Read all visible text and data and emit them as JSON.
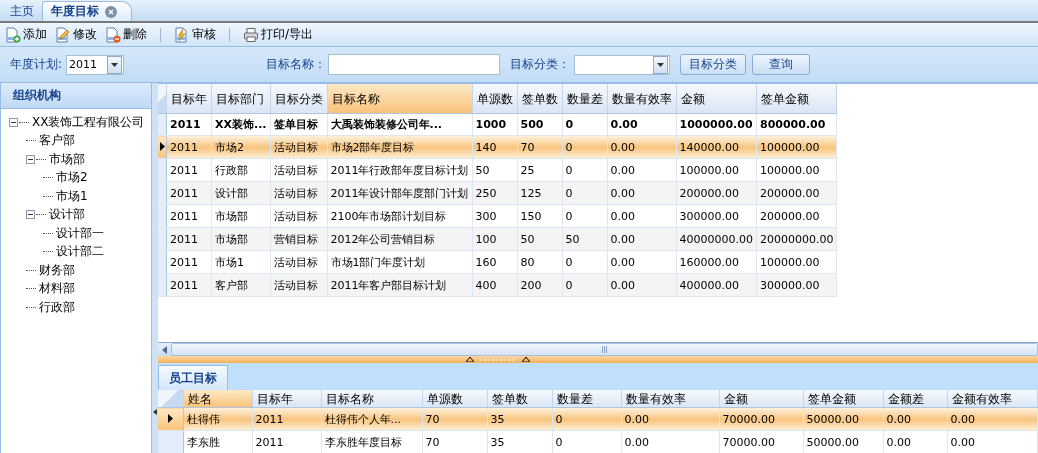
{
  "tabs": [
    {
      "label": "主页",
      "selected": false,
      "closable": false
    },
    {
      "label": "年度目标",
      "selected": true,
      "closable": true
    }
  ],
  "toolbar": [
    {
      "kind": "button",
      "label": "添加"
    },
    {
      "kind": "button",
      "label": "修改"
    },
    {
      "kind": "button",
      "label": "删除"
    },
    {
      "kind": "separator"
    },
    {
      "kind": "button",
      "label": "审核"
    },
    {
      "kind": "separator"
    },
    {
      "kind": "button",
      "label": "打印/导出"
    }
  ],
  "filters": {
    "year_plan": {
      "label": "年度计划:",
      "value": "2011"
    },
    "target_name": {
      "label": "目标名称："
    },
    "target_category": {
      "label": "目标分类："
    },
    "buttons": [
      "目标分类",
      "查询"
    ]
  },
  "sidebar": {
    "title": "组织机构",
    "tree": [
      {
        "label": "XX装饰工程有限公司",
        "expanded": true,
        "children": [
          {
            "label": "客户部"
          },
          {
            "label": "市场部",
            "expanded": true,
            "children": [
              {
                "label": "市场2"
              },
              {
                "label": "市场1"
              }
            ]
          },
          {
            "label": "设计部",
            "expanded": true,
            "children": [
              {
                "label": "设计部一"
              },
              {
                "label": "设计部二"
              }
            ]
          },
          {
            "label": "财务部"
          },
          {
            "label": "材料部"
          },
          {
            "label": "行政部"
          }
        ]
      }
    ]
  },
  "main_table": {
    "columns": [
      {
        "label": "目标年",
        "selected": false
      },
      {
        "label": "目标部门",
        "selected": false
      },
      {
        "label": "目标分类",
        "selected": false
      },
      {
        "label": "目标名称",
        "selected": true
      },
      {
        "label": "单源数",
        "selected": false
      },
      {
        "label": "签单数",
        "selected": false
      },
      {
        "label": "数量差",
        "selected": false
      },
      {
        "label": "数量有效率",
        "selected": false
      },
      {
        "label": "金额",
        "selected": false
      },
      {
        "label": "签单金额",
        "selected": false
      }
    ],
    "total_row": [
      "2011",
      "XX装饰...",
      "签单目标",
      "大禹装饰装修公司年...",
      "1000",
      "500",
      "0",
      "0.00",
      "1000000.00",
      "800000.00"
    ],
    "rows": [
      {
        "selected": true,
        "cells": [
          "2011",
          "市场2",
          "活动目标",
          "市场2部年度目标",
          "140",
          "70",
          "0",
          "0.00",
          "140000.00",
          "100000.00"
        ]
      },
      {
        "selected": false,
        "cells": [
          "2011",
          "行政部",
          "活动目标",
          "2011年行政部年度目标计划",
          "50",
          "25",
          "0",
          "0.00",
          "100000.00",
          "100000.00"
        ]
      },
      {
        "selected": false,
        "cells": [
          "2011",
          "设计部",
          "活动目标",
          "2011年设计部年度部门计划",
          "250",
          "125",
          "0",
          "0.00",
          "200000.00",
          "200000.00"
        ]
      },
      {
        "selected": false,
        "cells": [
          "2011",
          "市场部",
          "活动目标",
          "2100年市场部计划目标",
          "300",
          "150",
          "0",
          "0.00",
          "300000.00",
          "200000.00"
        ]
      },
      {
        "selected": false,
        "cells": [
          "2011",
          "市场部",
          "营销目标",
          "2012年公司营销目标",
          "100",
          "50",
          "50",
          "0.00",
          "40000000.00",
          "20000000.00"
        ]
      },
      {
        "selected": false,
        "cells": [
          "2011",
          "市场1",
          "活动目标",
          "市场1部门年度计划",
          "160",
          "80",
          "0",
          "0.00",
          "160000.00",
          "100000.00"
        ]
      },
      {
        "selected": false,
        "cells": [
          "2011",
          "客户部",
          "活动目标",
          "2011年客户部目标计划",
          "400",
          "200",
          "0",
          "0.00",
          "400000.00",
          "300000.00"
        ]
      }
    ]
  },
  "detail_tabs": [
    {
      "label": "员工目标",
      "selected": true
    }
  ],
  "employee_table": {
    "columns": [
      {
        "label": "姓名",
        "selected": true
      },
      {
        "label": "目标年",
        "selected": false
      },
      {
        "label": "目标名称",
        "selected": false
      },
      {
        "label": "单源数",
        "selected": false
      },
      {
        "label": "签单数",
        "selected": false
      },
      {
        "label": "数量差",
        "selected": false
      },
      {
        "label": "数量有效率",
        "selected": false
      },
      {
        "label": "金额",
        "selected": false
      },
      {
        "label": "签单金额",
        "selected": false
      },
      {
        "label": "金额差",
        "selected": false
      },
      {
        "label": "金额有效率",
        "selected": false
      }
    ],
    "rows": [
      {
        "selected": true,
        "cells": [
          "杜得伟",
          "2011",
          "杜得伟个人年...",
          "70",
          "35",
          "0",
          "0.00",
          "70000.00",
          "50000.00",
          "0.00",
          "0.00"
        ]
      },
      {
        "selected": false,
        "cells": [
          "李东胜",
          "2011",
          "李东胜年度目标",
          "70",
          "35",
          "0",
          "0.00",
          "70000.00",
          "50000.00",
          "0.00",
          "0.00"
        ]
      }
    ]
  }
}
